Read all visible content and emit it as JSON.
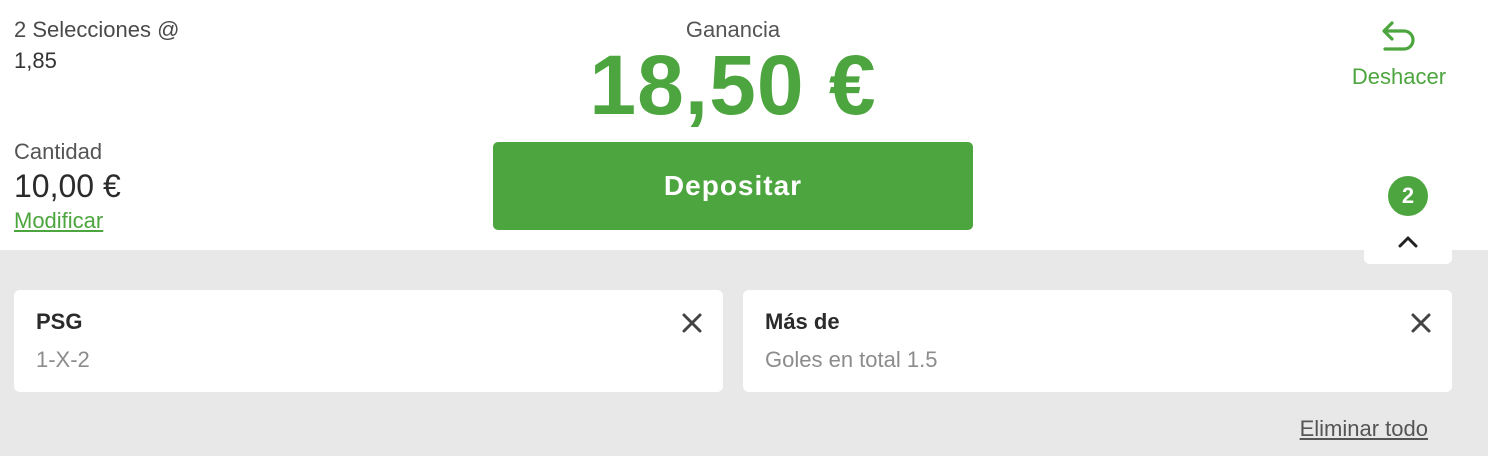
{
  "summary": {
    "selections_label": "2 Selecciones @",
    "odds": "1,85",
    "quantity_label": "Cantidad",
    "quantity_value": "10,00 €",
    "modify_link": "Modificar"
  },
  "gain": {
    "label": "Ganancia",
    "value": "18,50 €"
  },
  "deposit_button": "Depositar",
  "undo": {
    "label": "Deshacer",
    "icon": "undo-arrow-icon"
  },
  "collapse_tab": {
    "count": "2",
    "icon": "chevron-up-icon"
  },
  "selections": [
    {
      "title": "PSG",
      "market": "1-X-2",
      "close_icon": "close-icon"
    },
    {
      "title": "Más de",
      "market": "Goles en total 1.5",
      "close_icon": "close-icon"
    }
  ],
  "remove_all_link": "Eliminar todo",
  "colors": {
    "accent": "#4ca53e",
    "panel_bg": "#e8e8e8",
    "card_bg": "#ffffff"
  }
}
